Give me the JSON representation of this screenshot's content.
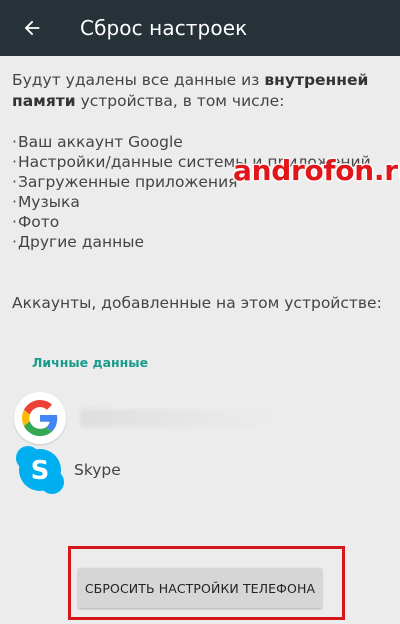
{
  "appbar": {
    "title": "Сброс настроек",
    "back_icon": "arrow-left-icon",
    "background": "#263238"
  },
  "intro": {
    "before": "Будут удалены все данные из ",
    "bold": "внутренней памяти",
    "after": " устройства, в том числе:"
  },
  "items": [
    "Ваш аккаунт Google",
    "Настройки/данные системы и приложений",
    "Загруженные приложения",
    "Музыка",
    "Фото",
    "Другие данные"
  ],
  "watermark": "androfon.ru",
  "accounts_note": "Аккаунты, добавленные на этом устройстве:",
  "section_header": "Личные данные",
  "accounts": [
    {
      "icon": "google-icon",
      "label": ""
    },
    {
      "icon": "skype-icon",
      "label": "Skype"
    }
  ],
  "reset_button": "СБРОСИТЬ НАСТРОЙКИ ТЕЛЕФОНА",
  "colors": {
    "accent": "#1a9c8c",
    "highlight": "#d5161c",
    "watermark": "#e0161b"
  }
}
